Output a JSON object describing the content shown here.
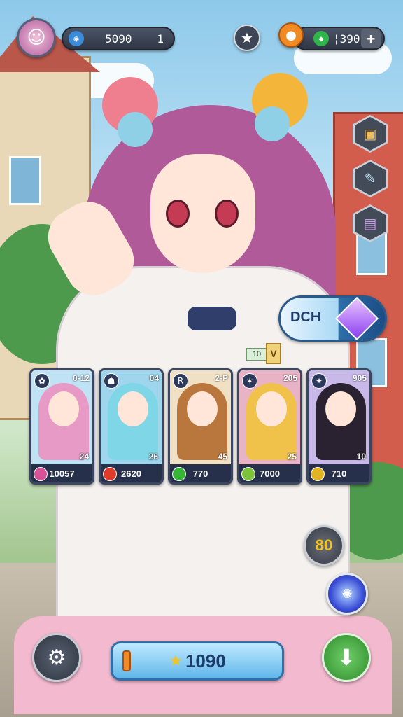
{
  "hud": {
    "avatar_icon": "avatar-icon",
    "left_bar": {
      "icon": "coin-icon",
      "value": "5090",
      "count": "1"
    },
    "star_button": "star-icon",
    "right_bar": {
      "icon": "gem-icon",
      "value": "¦390",
      "plus": "+"
    },
    "fruit_icon": "fruit-icon"
  },
  "side_buttons": [
    {
      "icon": "chest-icon",
      "glyph": "▣"
    },
    {
      "icon": "scroll-icon",
      "glyph": "✎"
    },
    {
      "icon": "ticket-icon",
      "glyph": "▤"
    }
  ],
  "feature_button": {
    "label": "DCH"
  },
  "tags": {
    "ten": "10",
    "v": "V"
  },
  "cards": [
    {
      "top_number": "0-12",
      "level": "24",
      "value": "10057",
      "hair": "#e79ac5",
      "bg": "#bfe3f5",
      "orb": "#d6539a"
    },
    {
      "top_number": "04",
      "level": "26",
      "value": "2620",
      "hair": "#7fd6e6",
      "bg": "#9fd6ee",
      "orb": "#e03a2a"
    },
    {
      "top_number": "2-P",
      "level": "45",
      "value": "770",
      "hair": "#b9773e",
      "bg": "#f0e1c5",
      "orb": "#37b537"
    },
    {
      "top_number": "205",
      "level": "25",
      "value": "7000",
      "hair": "#f0c24a",
      "bg": "#e9b3c6",
      "orb": "#7cc23a"
    },
    {
      "top_number": "905",
      "level": "10",
      "value": "710",
      "hair": "#2a2230",
      "bg": "#c8b9e9",
      "orb": "#e2b323"
    }
  ],
  "bottom": {
    "left_icon": "gear-icon",
    "main_value": "1090",
    "right_icon": "download-icon",
    "side_count": "80"
  }
}
